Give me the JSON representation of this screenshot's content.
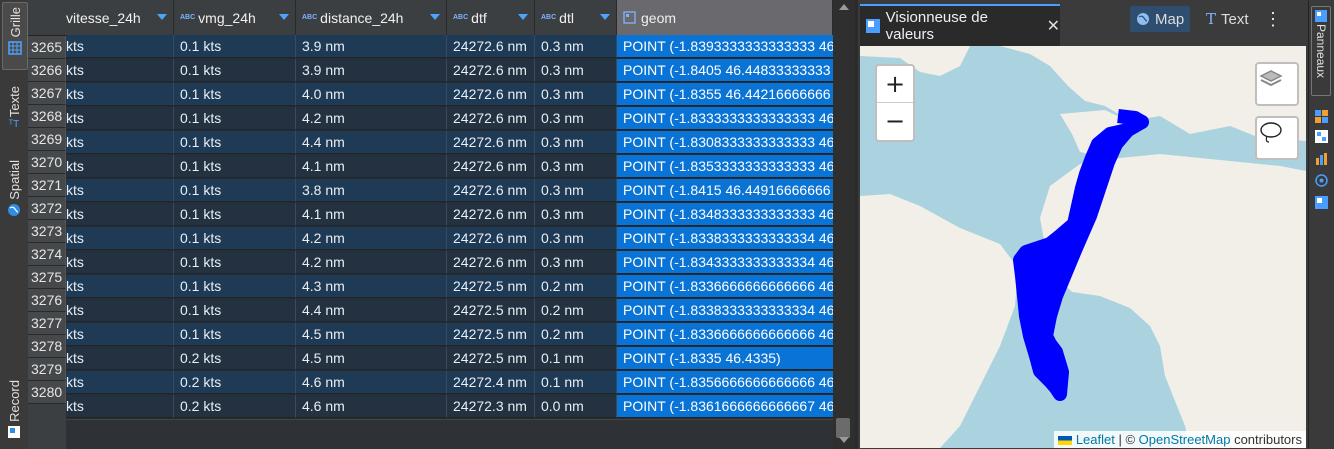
{
  "left_tabs": [
    {
      "label": "Grille",
      "icon": "grid-icon"
    },
    {
      "label": "Texte",
      "icon": "text-icon"
    },
    {
      "label": "Spatial",
      "icon": "globe-icon"
    },
    {
      "label": "Record",
      "icon": "record-icon"
    }
  ],
  "columns": [
    {
      "label": "vitesse_24h"
    },
    {
      "label": "vmg_24h"
    },
    {
      "label": "distance_24h"
    },
    {
      "label": "dtf"
    },
    {
      "label": "dtl"
    },
    {
      "label": "geom"
    }
  ],
  "rows": [
    {
      "n": "3265",
      "c": [
        "kts",
        "0.1 kts",
        "3.9 nm",
        "24272.6 nm",
        "0.3 nm",
        "POINT (-1.8393333333333333 46"
      ]
    },
    {
      "n": "3266",
      "c": [
        "kts",
        "0.1 kts",
        "3.9 nm",
        "24272.6 nm",
        "0.3 nm",
        "POINT (-1.8405 46.44833333333"
      ]
    },
    {
      "n": "3267",
      "c": [
        "kts",
        "0.1 kts",
        "4.0 nm",
        "24272.6 nm",
        "0.3 nm",
        "POINT (-1.8355 46.44216666666"
      ]
    },
    {
      "n": "3268",
      "c": [
        "kts",
        "0.1 kts",
        "4.2 nm",
        "24272.6 nm",
        "0.3 nm",
        "POINT (-1.8333333333333333 46"
      ]
    },
    {
      "n": "3269",
      "c": [
        "kts",
        "0.1 kts",
        "4.4 nm",
        "24272.6 nm",
        "0.3 nm",
        "POINT (-1.8308333333333333 46"
      ]
    },
    {
      "n": "3270",
      "c": [
        "kts",
        "0.1 kts",
        "4.1 nm",
        "24272.6 nm",
        "0.3 nm",
        "POINT (-1.8353333333333333 46"
      ]
    },
    {
      "n": "3271",
      "c": [
        "kts",
        "0.1 kts",
        "3.8 nm",
        "24272.6 nm",
        "0.3 nm",
        "POINT (-1.8415 46.44916666666"
      ]
    },
    {
      "n": "3272",
      "c": [
        "kts",
        "0.1 kts",
        "4.1 nm",
        "24272.6 nm",
        "0.3 nm",
        "POINT (-1.8348333333333333 46"
      ]
    },
    {
      "n": "3273",
      "c": [
        "kts",
        "0.1 kts",
        "4.2 nm",
        "24272.6 nm",
        "0.3 nm",
        "POINT (-1.8338333333333334 46"
      ]
    },
    {
      "n": "3274",
      "c": [
        "kts",
        "0.1 kts",
        "4.2 nm",
        "24272.6 nm",
        "0.3 nm",
        "POINT (-1.8343333333333334 46"
      ]
    },
    {
      "n": "3275",
      "c": [
        "kts",
        "0.1 kts",
        "4.3 nm",
        "24272.5 nm",
        "0.2 nm",
        "POINT (-1.8336666666666666 46"
      ]
    },
    {
      "n": "3276",
      "c": [
        "kts",
        "0.1 kts",
        "4.4 nm",
        "24272.5 nm",
        "0.2 nm",
        "POINT (-1.8338333333333334 46"
      ]
    },
    {
      "n": "3277",
      "c": [
        "kts",
        "0.1 kts",
        "4.5 nm",
        "24272.5 nm",
        "0.2 nm",
        "POINT (-1.8336666666666666 46"
      ]
    },
    {
      "n": "3278",
      "c": [
        "kts",
        "0.2 kts",
        "4.5 nm",
        "24272.5 nm",
        "0.1 nm",
        "POINT (-1.8335 46.4335)"
      ]
    },
    {
      "n": "3279",
      "c": [
        "kts",
        "0.2 kts",
        "4.6 nm",
        "24272.4 nm",
        "0.1 nm",
        "POINT (-1.8356666666666666 46"
      ]
    },
    {
      "n": "3280",
      "c": [
        "kts",
        "0.2 kts",
        "4.6 nm",
        "24272.3 nm",
        "0.0 nm",
        "POINT (-1.8361666666666667 46"
      ]
    }
  ],
  "viewer": {
    "title": "Visionneuse de valeurs",
    "close": "✕",
    "map_label": "Map",
    "text_label": "Text",
    "menu": "⋮"
  },
  "map": {
    "zoom_in": "+",
    "zoom_out": "−",
    "attr_leaflet": "Leaflet",
    "attr_sep": " | © ",
    "attr_osm": "OpenStreetMap",
    "attr_tail": " contributors"
  },
  "right_panel": {
    "label": "Panneaux"
  },
  "colors": {
    "accent": "#0a74d6",
    "track": "#0000ff",
    "sea": "#aad3df",
    "land": "#f2efe9"
  }
}
